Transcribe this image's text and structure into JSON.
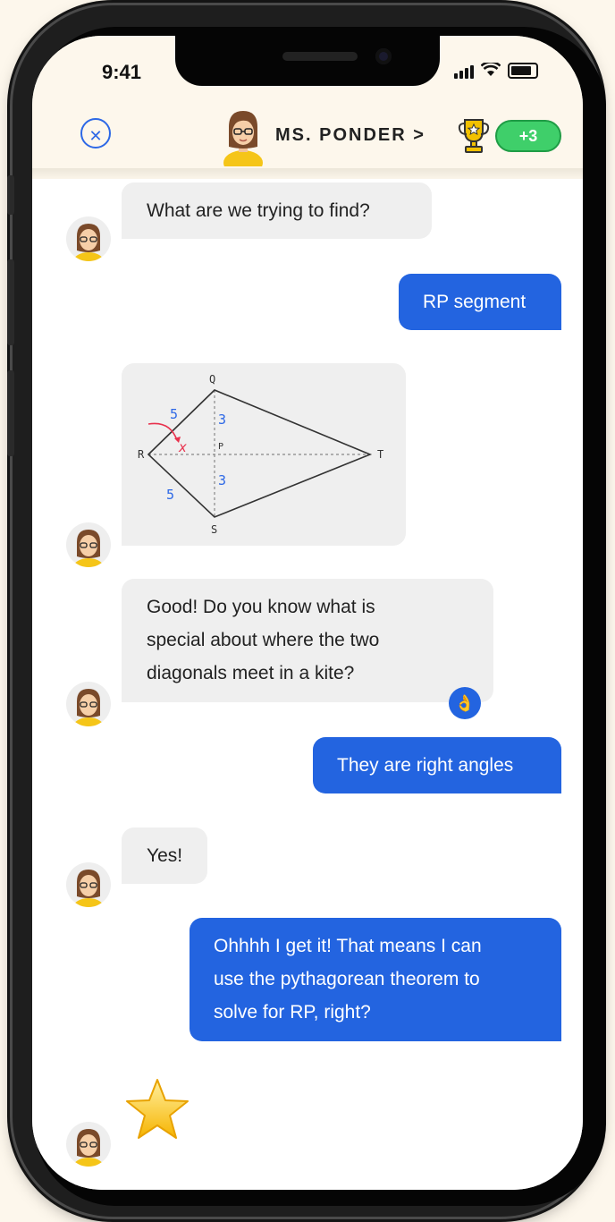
{
  "status_bar": {
    "time": "9:41"
  },
  "header": {
    "teacher_name": "MS. PONDER >",
    "points_badge": "+3",
    "close_symbol": "✕"
  },
  "diagram": {
    "vertices": {
      "q": "Q",
      "r": "R",
      "s": "S",
      "t": "T",
      "p": "P"
    },
    "side_labels": {
      "rq": "5",
      "rs": "5",
      "qp": "3",
      "ps": "3"
    },
    "unknown_label": "x"
  },
  "messages": [
    {
      "sender": "teacher",
      "text": "What are we trying to find?"
    },
    {
      "sender": "student",
      "text": "RP segment"
    },
    {
      "sender": "teacher",
      "kind": "image"
    },
    {
      "sender": "teacher",
      "lines": [
        "Good! Do you know what is",
        "special about where the two",
        "diagonals meet in a kite?"
      ],
      "reaction": "👌"
    },
    {
      "sender": "student",
      "text": "They are right angles"
    },
    {
      "sender": "teacher",
      "text": "Yes!"
    },
    {
      "sender": "student",
      "lines": [
        "Ohhhh I get it! That means I can",
        "use the pythagorean theorem to",
        "solve for RP, right?"
      ]
    },
    {
      "sender": "teacher",
      "kind": "sticker",
      "icon": "star-icon"
    }
  ],
  "icons": [
    "close-icon",
    "trophy-icon",
    "star-icon",
    "ok-hand-icon",
    "signal-icon",
    "wifi-icon",
    "battery-icon"
  ],
  "colors": {
    "outgoing_bubble": "#2364e0",
    "incoming_bubble": "#efefef",
    "badge": "#3fcf6a",
    "accent": "#2d68e6",
    "annotation_red": "#e8314d",
    "annotation_blue": "#2d68e6"
  }
}
